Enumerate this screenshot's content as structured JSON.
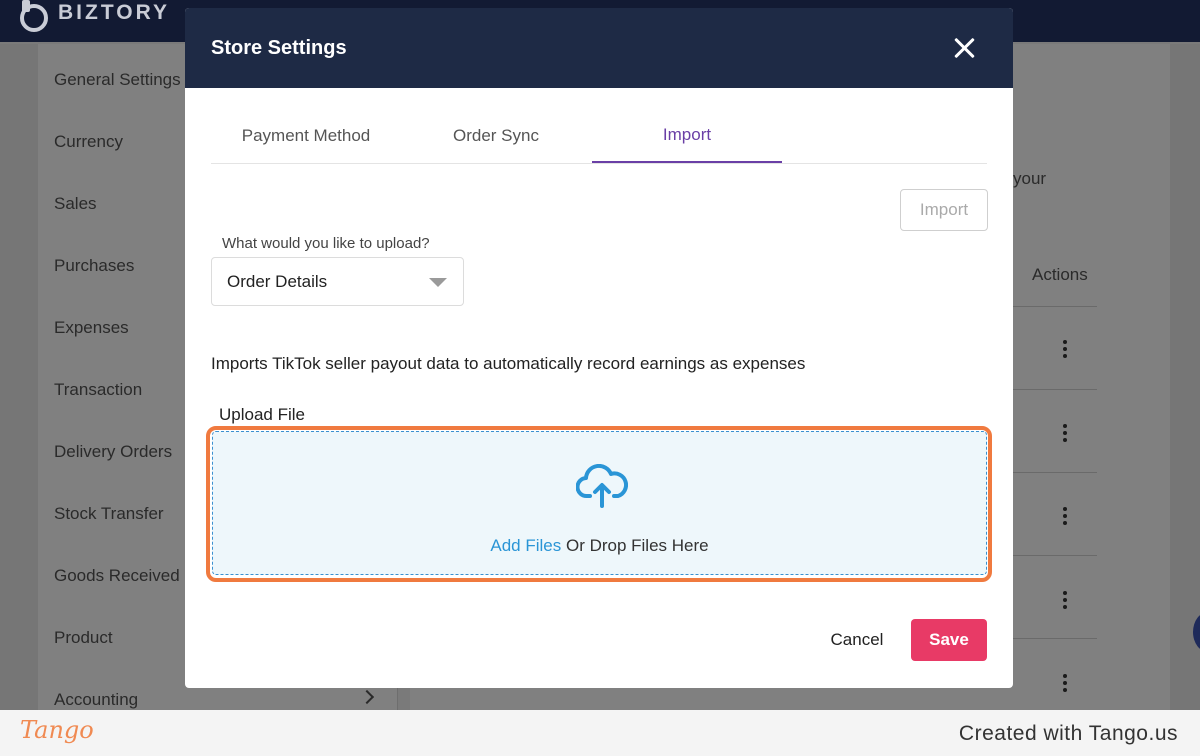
{
  "app": {
    "brand": "BIZTORY"
  },
  "sidebar": {
    "items": [
      {
        "label": "General Settings"
      },
      {
        "label": "Currency"
      },
      {
        "label": "Sales"
      },
      {
        "label": "Purchases"
      },
      {
        "label": "Expenses"
      },
      {
        "label": "Transaction"
      },
      {
        "label": "Delivery Orders"
      },
      {
        "label": "Stock Transfer"
      },
      {
        "label": "Goods Received"
      },
      {
        "label": "Product"
      },
      {
        "label": "Accounting"
      }
    ]
  },
  "background": {
    "partial_text": "your",
    "actions_header": "Actions"
  },
  "modal": {
    "title": "Store Settings",
    "tabs": [
      {
        "label": "Payment Method",
        "active": false
      },
      {
        "label": "Order Sync",
        "active": false
      },
      {
        "label": "Import",
        "active": true
      }
    ],
    "import_button": "Import",
    "upload_question": "What would you like to upload?",
    "upload_type_selected": "Order Details",
    "description": "Imports TikTok seller payout data to automatically record earnings as expenses",
    "upload_file_label": "Upload File",
    "dropzone": {
      "add_files": "Add Files",
      "drop_text": " Or Drop Files Here"
    },
    "cancel": "Cancel",
    "save": "Save"
  },
  "footer": {
    "logo": "Tango",
    "created_with": "Created with Tango.us"
  },
  "colors": {
    "modal_header": "#1e2a45",
    "active_tab": "#6a3fa6",
    "save": "#e83a66",
    "highlight": "#f07a3f",
    "link": "#2a95d6"
  }
}
